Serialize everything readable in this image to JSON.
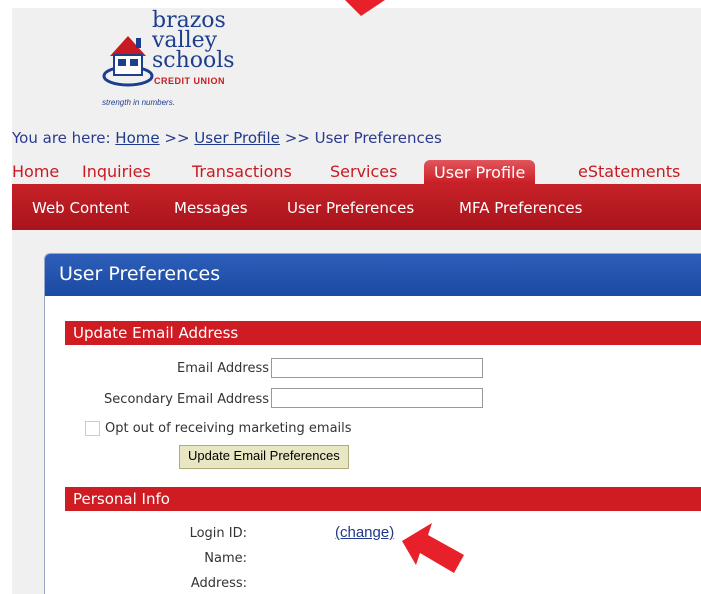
{
  "logo": {
    "line1": "brazos",
    "line2": "valley",
    "line3": "schools",
    "credit_union": "CREDIT UNION",
    "tagline": "strength in numbers."
  },
  "breadcrumb": {
    "prefix": "You are here:",
    "home": "Home",
    "sep1": ">>",
    "user_profile": "User Profile",
    "sep2": ">>",
    "current": "User Preferences"
  },
  "tabs": [
    {
      "label": "Home"
    },
    {
      "label": "Inquiries"
    },
    {
      "label": "Transactions"
    },
    {
      "label": "Services"
    },
    {
      "label": "User Profile"
    },
    {
      "label": "eStatements"
    }
  ],
  "subnav": [
    {
      "label": "Web Content"
    },
    {
      "label": "Messages"
    },
    {
      "label": "User Preferences"
    },
    {
      "label": "MFA Preferences"
    }
  ],
  "panel": {
    "title": "User Preferences",
    "email_section": {
      "title": "Update Email Address",
      "email_label": "Email Address",
      "email_value": "",
      "secondary_label": "Secondary Email Address",
      "secondary_value": "",
      "optout_label": "Opt out of receiving marketing emails",
      "button_label": "Update Email Preferences"
    },
    "personal_section": {
      "title": "Personal Info",
      "login_label": "Login ID:",
      "change_link": "(change)",
      "name_label": "Name:",
      "address_label": "Address:"
    }
  },
  "colors": {
    "brand_red": "#cf1b22",
    "brand_blue": "#1a4aa3",
    "link_blue": "#1f3a8a",
    "annotation_arrow": "#e8202a"
  }
}
